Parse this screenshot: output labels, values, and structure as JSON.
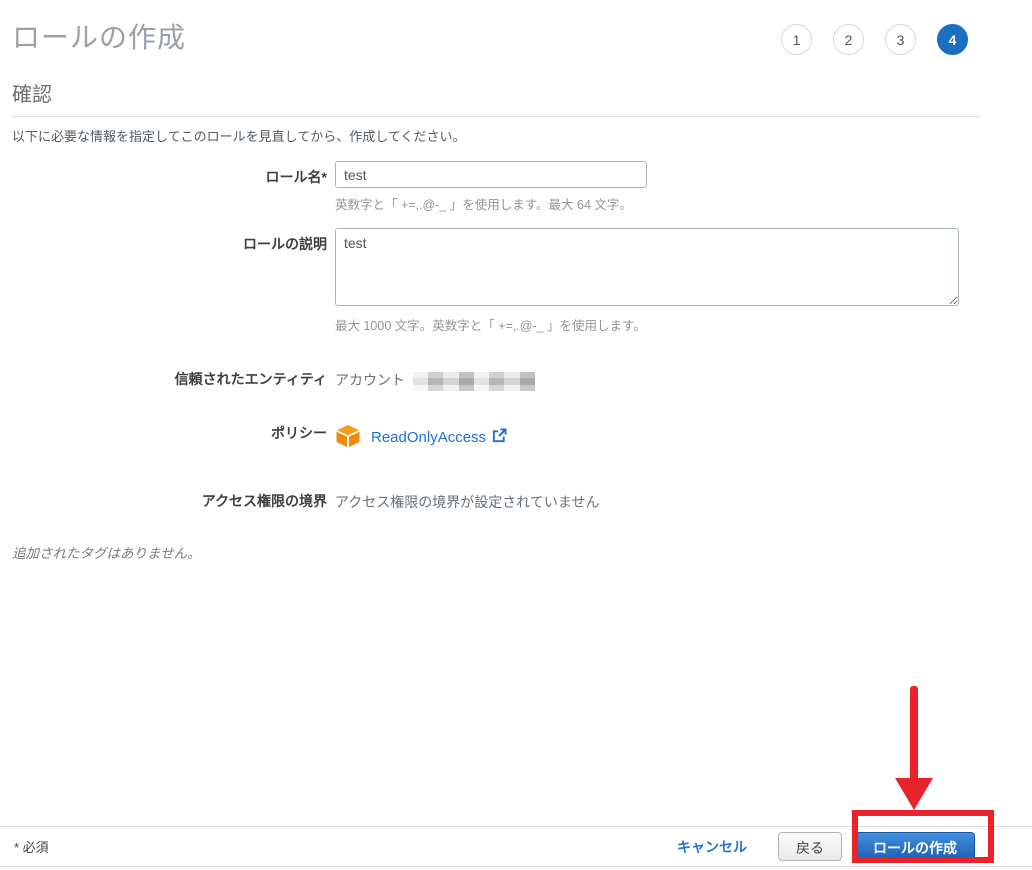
{
  "page": {
    "title": "ロールの作成",
    "section_heading": "確認",
    "lead": "以下に必要な情報を指定してこのロールを見直してから、作成してください。"
  },
  "steps": {
    "items": [
      {
        "label": "1"
      },
      {
        "label": "2"
      },
      {
        "label": "3"
      },
      {
        "label": "4"
      }
    ],
    "active_step": "4"
  },
  "form": {
    "role_name": {
      "label": "ロール名*",
      "value": "test",
      "helper": "英数字と「 +=,.@-_ 」を使用します。最大 64 文字。"
    },
    "role_description": {
      "label": "ロールの説明",
      "value": "test",
      "helper": "最大 1000 文字。英数字と「 +=,.@-_ 」を使用します。"
    },
    "trusted_entities": {
      "label": "信頼されたエンティティ",
      "value_prefix": "アカウント",
      "value_redacted": true
    },
    "policies": {
      "label": "ポリシー",
      "policy_name": "ReadOnlyAccess"
    },
    "permissions_boundary": {
      "label": "アクセス権限の境界",
      "value": "アクセス権限の境界が設定されていません"
    }
  },
  "tags_note": "追加されたタグはありません。",
  "footer": {
    "required_note": "* 必須",
    "cancel_label": "キャンセル",
    "back_label": "戻る",
    "create_label": "ロールの作成"
  },
  "colors": {
    "step_active_blue": "#1a6fc0",
    "link_blue": "#1f6fd6",
    "primary_button_top": "#418fde",
    "primary_button_bottom": "#1a5eb4",
    "annotation_red": "#e8242a",
    "policy_icon_orange": "#f68d11"
  }
}
